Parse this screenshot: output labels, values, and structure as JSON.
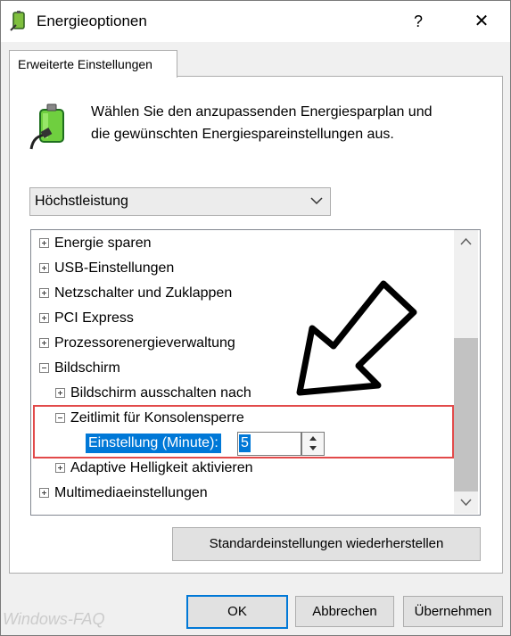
{
  "window": {
    "title": "Energieoptionen",
    "help_label": "?",
    "close_label": "✕"
  },
  "tab": {
    "label": "Erweiterte Einstellungen"
  },
  "intro": {
    "text_line1": "Wählen Sie den anzupassenden Energiesparplan und",
    "text_line2": "die gewünschten Energiespareinstellungen aus."
  },
  "plan_select": {
    "value": "Höchstleistung"
  },
  "tree": {
    "items": [
      {
        "label": "Energie sparen",
        "expander": "+",
        "level": 0
      },
      {
        "label": "USB-Einstellungen",
        "expander": "+",
        "level": 0
      },
      {
        "label": "Netzschalter und Zuklappen",
        "expander": "+",
        "level": 0
      },
      {
        "label": "PCI Express",
        "expander": "+",
        "level": 0
      },
      {
        "label": "Prozessorenergieverwaltung",
        "expander": "+",
        "level": 0
      },
      {
        "label": "Bildschirm",
        "expander": "-",
        "level": 0
      },
      {
        "label": "Bildschirm ausschalten nach",
        "expander": "+",
        "level": 1
      },
      {
        "label": "Zeitlimit für Konsolensperre",
        "expander": "-",
        "level": 1
      },
      {
        "label": "Adaptive Helligkeit aktivieren",
        "expander": "+",
        "level": 1
      },
      {
        "label": "Multimediaeinstellungen",
        "expander": "+",
        "level": 0
      }
    ],
    "setting_label": "Einstellung (Minute):",
    "setting_value": "5"
  },
  "buttons": {
    "restore": "Standardeinstellungen wiederherstellen",
    "ok": "OK",
    "cancel": "Abbrechen",
    "apply": "Übernehmen"
  },
  "watermark": "Windows-FAQ",
  "colors": {
    "accent": "#0078d7",
    "highlight_border": "#e24a4a"
  }
}
